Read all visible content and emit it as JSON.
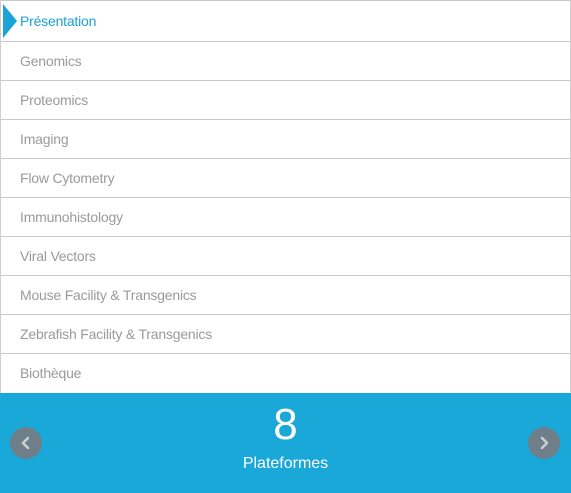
{
  "menu": {
    "items": [
      {
        "label": "Présentation",
        "active": true
      },
      {
        "label": "Genomics",
        "active": false
      },
      {
        "label": "Proteomics",
        "active": false
      },
      {
        "label": "Imaging",
        "active": false
      },
      {
        "label": "Flow Cytometry",
        "active": false
      },
      {
        "label": "Immunohistology",
        "active": false
      },
      {
        "label": "Viral Vectors",
        "active": false
      },
      {
        "label": "Mouse Facility & Transgenics",
        "active": false
      },
      {
        "label": "Zebrafish Facility & Transgenics",
        "active": false
      },
      {
        "label": "Biothèque",
        "active": false
      }
    ]
  },
  "banner": {
    "count": "8",
    "label": "Plateformes",
    "prev_icon": "chevron-left-icon",
    "next_icon": "chevron-right-icon"
  },
  "colors": {
    "accent": "#1aa3d4",
    "banner_bg": "#1aa8d8",
    "inactive_text": "#9a9a9a",
    "nav_button": "#6e7f89"
  }
}
